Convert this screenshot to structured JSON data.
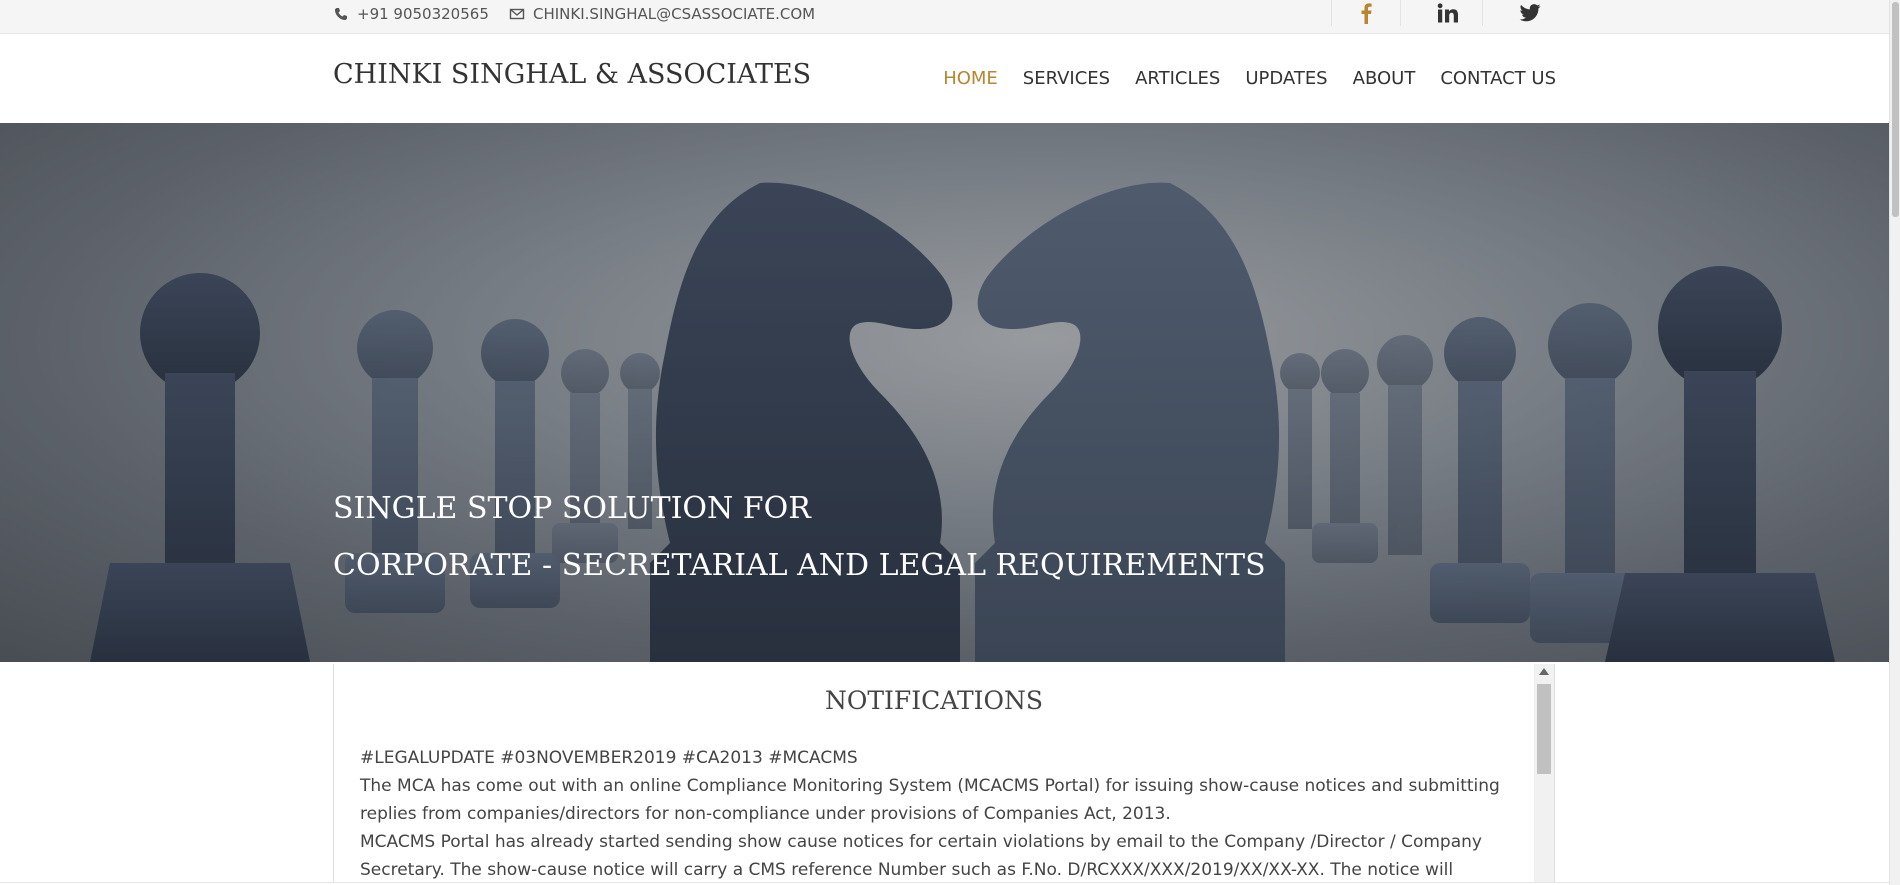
{
  "topbar": {
    "phone": "+91 9050320565",
    "email": "CHINKI.SINGHAL@CSASSOCIATE.COM",
    "phone_icon": "phone-icon",
    "email_icon": "envelope-icon",
    "social": [
      {
        "icon": "facebook-icon",
        "color": "#b8862f"
      },
      {
        "icon": "linkedin-icon",
        "color": "#333333"
      },
      {
        "icon": "twitter-icon",
        "color": "#333333"
      }
    ]
  },
  "header": {
    "logo": "CHINKI SINGHAL & ASSOCIATES",
    "nav": [
      {
        "label": "HOME",
        "active": true
      },
      {
        "label": "SERVICES",
        "active": false
      },
      {
        "label": "ARTICLES",
        "active": false
      },
      {
        "label": "UPDATES",
        "active": false
      },
      {
        "label": "ABOUT",
        "active": false
      },
      {
        "label": "CONTACT US",
        "active": false
      }
    ],
    "accent_color": "#b8862f"
  },
  "hero": {
    "line1": "SINGLE STOP SOLUTION FOR",
    "line2": "CORPORATE - SECRETARIAL AND LEGAL REQUIREMENTS"
  },
  "notifications": {
    "title": "NOTIFICATIONS",
    "paragraphs": [
      "#LEGALUPDATE #03NOVEMBER2019 #CA2013 #MCACMS",
      "The MCA has come out with an online Compliance Monitoring System (MCACMS Portal) for issuing show-cause notices and submitting replies from companies/directors for non-compliance under provisions of Companies Act, 2013.",
      "MCACMS Portal has already started sending show cause notices for certain violations by email to the Company /Director / Company Secretary. The show-cause notice will carry a CMS reference Number such as F.No. D/RCXXX/XXX/2019/XX/XX-XX. The notice will"
    ]
  }
}
